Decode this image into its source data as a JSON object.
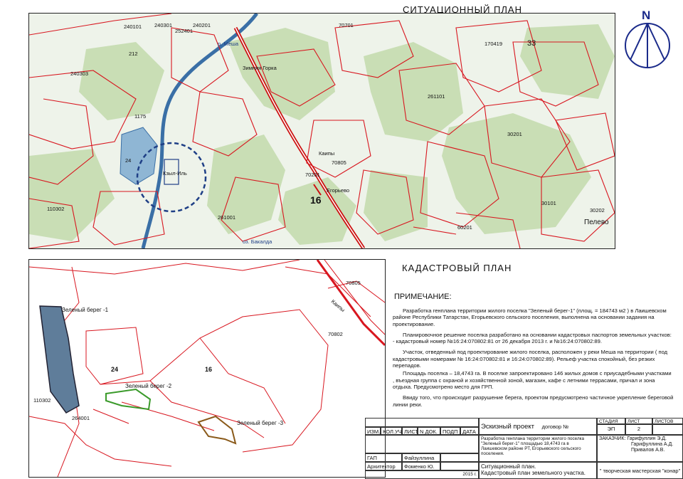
{
  "titles": {
    "situational": "СИТУАЦИОННЫЙ ПЛАН",
    "cadastral": "КАДАСТРОВЫЙ ПЛАН",
    "north": "N"
  },
  "situational_map": {
    "labels": {
      "reka": "р. Меша",
      "zimnyaya_gorka": "Зимняя Горка",
      "kaipy": "Каипы",
      "kyzyl_il": "Кзыл-Иль",
      "egorevo": "Егорьево",
      "pelevo": "Пелево",
      "road16": "16",
      "bakalda": "оз. Бакалда",
      "n240101": "240101",
      "n240301": "240301",
      "n252401": "252401",
      "n240201": "240201",
      "n70701": "70701",
      "n170419": "170419",
      "n33": "33",
      "n240303": "240303",
      "n261101": "261101",
      "n30201": "30201",
      "n70805": "70805",
      "n70201": "70201",
      "n261001": "261001",
      "n110302": "110302",
      "n60201": "60201",
      "n30101": "30101",
      "n30202": "30202",
      "n24": "24",
      "n1175": "1175",
      "n212": "212"
    }
  },
  "cadastral_map": {
    "labels": {
      "bereg1": "Зеленый берег -1",
      "bereg2": "Зеленый берег -2",
      "bereg3": "Зеленый берег -3",
      "n24": "24",
      "n16": "16",
      "kaipy": "Каипы",
      "n70805": "70805",
      "n70802": "70802",
      "n110302": "110302",
      "n264001": "264001"
    }
  },
  "notes": {
    "heading": "ПРИМЕЧАНИЕ:",
    "p1": "Разработка генплана территории жилого поселка \"Зеленый берег-1\" (площ. = 184743 м2 ) в Лаишевском районе Республики Татарстан, Егорьевского сельского поселения, выполнена на основании задания на проектирование.",
    "p2": "Планировочное решение поселка разработано на основании кадастровых паспортов земельных участков: - кадастровый номер №16:24:070802:81 от 26 декабря 2013 г. и №16:24:070802:89.",
    "p3": "Участок, отведенный под проектирование жилого поселка, расположен у реки Меша на территории ( под кадастровыми номерами № 16:24:070802:81 и 16:24:070802:89). Рельеф участка спокойный, без резких перепадов.",
    "p4": "Площадь поселка – 18,4743 га. В поселке запроектировано 146 жилых домов с приусадебными участками , въездная группа с охраной и хозяйственной зоной, магазин, кафе с летними террасами, причал и зона отдыха. Предусмотрено место для ГРП.",
    "p5": "Ввиду того, что происходит разрушение берега, проектом предусмотрено частичное укрепление береговой линии реки."
  },
  "title_block": {
    "h_izm": "ИЗМ.",
    "h_kol": "КОЛ.УЧ",
    "h_list": "ЛИСТ",
    "h_ndok": "N ДОК.",
    "h_podp": "ПОДП",
    "h_data": "ДАТА",
    "project": "Эскизный проект",
    "contract": "договор №",
    "h_stadiya": "СТАДИЯ",
    "h_list2": "ЛИСТ",
    "h_listov": "ЛИСТОВ",
    "stadiya": "ЭП",
    "list": "2",
    "description": "Разработка генплана территории жилого поселка \"Зеленый берег-1\" площадью 18,4743 га в Лаишевском районе РТ, Егорьевского сельского поселения.",
    "customer_label": "ЗАКАЗЧИК:",
    "customers": [
      "Гарифуллин Э.Д.",
      "Гарифуллина А.Д.",
      "Привалов А.В."
    ],
    "gap_role": "ГАП",
    "gap_name": "Файзуллина Г.",
    "arch_role": "Архитектор",
    "arch_name": "Фоменко Ю.",
    "year": "2015 г.",
    "sheet_title1": "Ситуационный план.",
    "sheet_title2": "Кадастровый план земельного участка.",
    "studio": "\" творческая мастерская \"конар\""
  },
  "colors": {
    "boundary": "#d8161f",
    "road": "#cc1010",
    "forest": "#c9deb5",
    "water": "#8fb6d4",
    "river": "#3a6fa6",
    "circle": "#1f3f86",
    "plot1": "#5f7d9a",
    "plot2": "#3a9a2a",
    "plot3": "#8a5a1a"
  }
}
